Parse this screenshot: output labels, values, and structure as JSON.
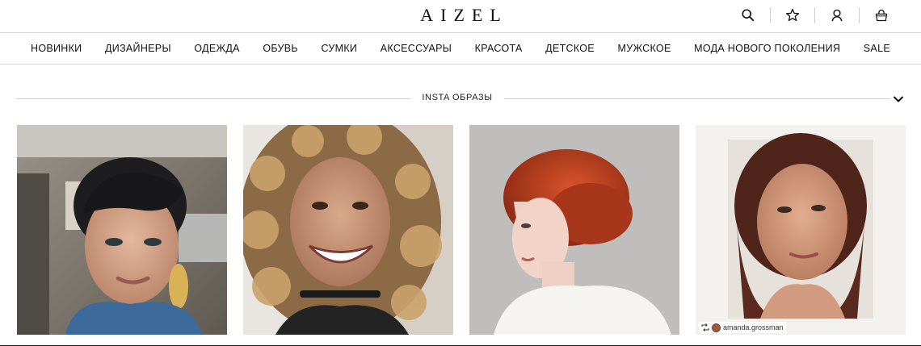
{
  "header": {
    "logo": "AIZEL",
    "icons": [
      "search-icon",
      "star-icon",
      "user-icon",
      "bag-icon"
    ]
  },
  "nav": {
    "items": [
      "НОВИНКИ",
      "ДИЗАЙНЕРЫ",
      "ОДЕЖДА",
      "ОБУВЬ",
      "СУМКИ",
      "АКСЕССУАРЫ",
      "КРАСОТА",
      "ДЕТСКОЕ",
      "МУЖСКОЕ",
      "МОДА НОВОГО ПОКОЛЕНИЯ",
      "SALE"
    ]
  },
  "section": {
    "title": "INSTA ОБРАЗЫ"
  },
  "photos": [
    {
      "name": "insta-photo-dark-hair-selfie"
    },
    {
      "name": "insta-photo-curly-hair-smile"
    },
    {
      "name": "insta-photo-red-hair-bun"
    },
    {
      "name": "insta-photo-freckled-portrait",
      "credit": "amanda.grossman"
    }
  ],
  "colors": {
    "text": "#111111",
    "divider": "#d8d8d8",
    "background": "#ffffff"
  }
}
